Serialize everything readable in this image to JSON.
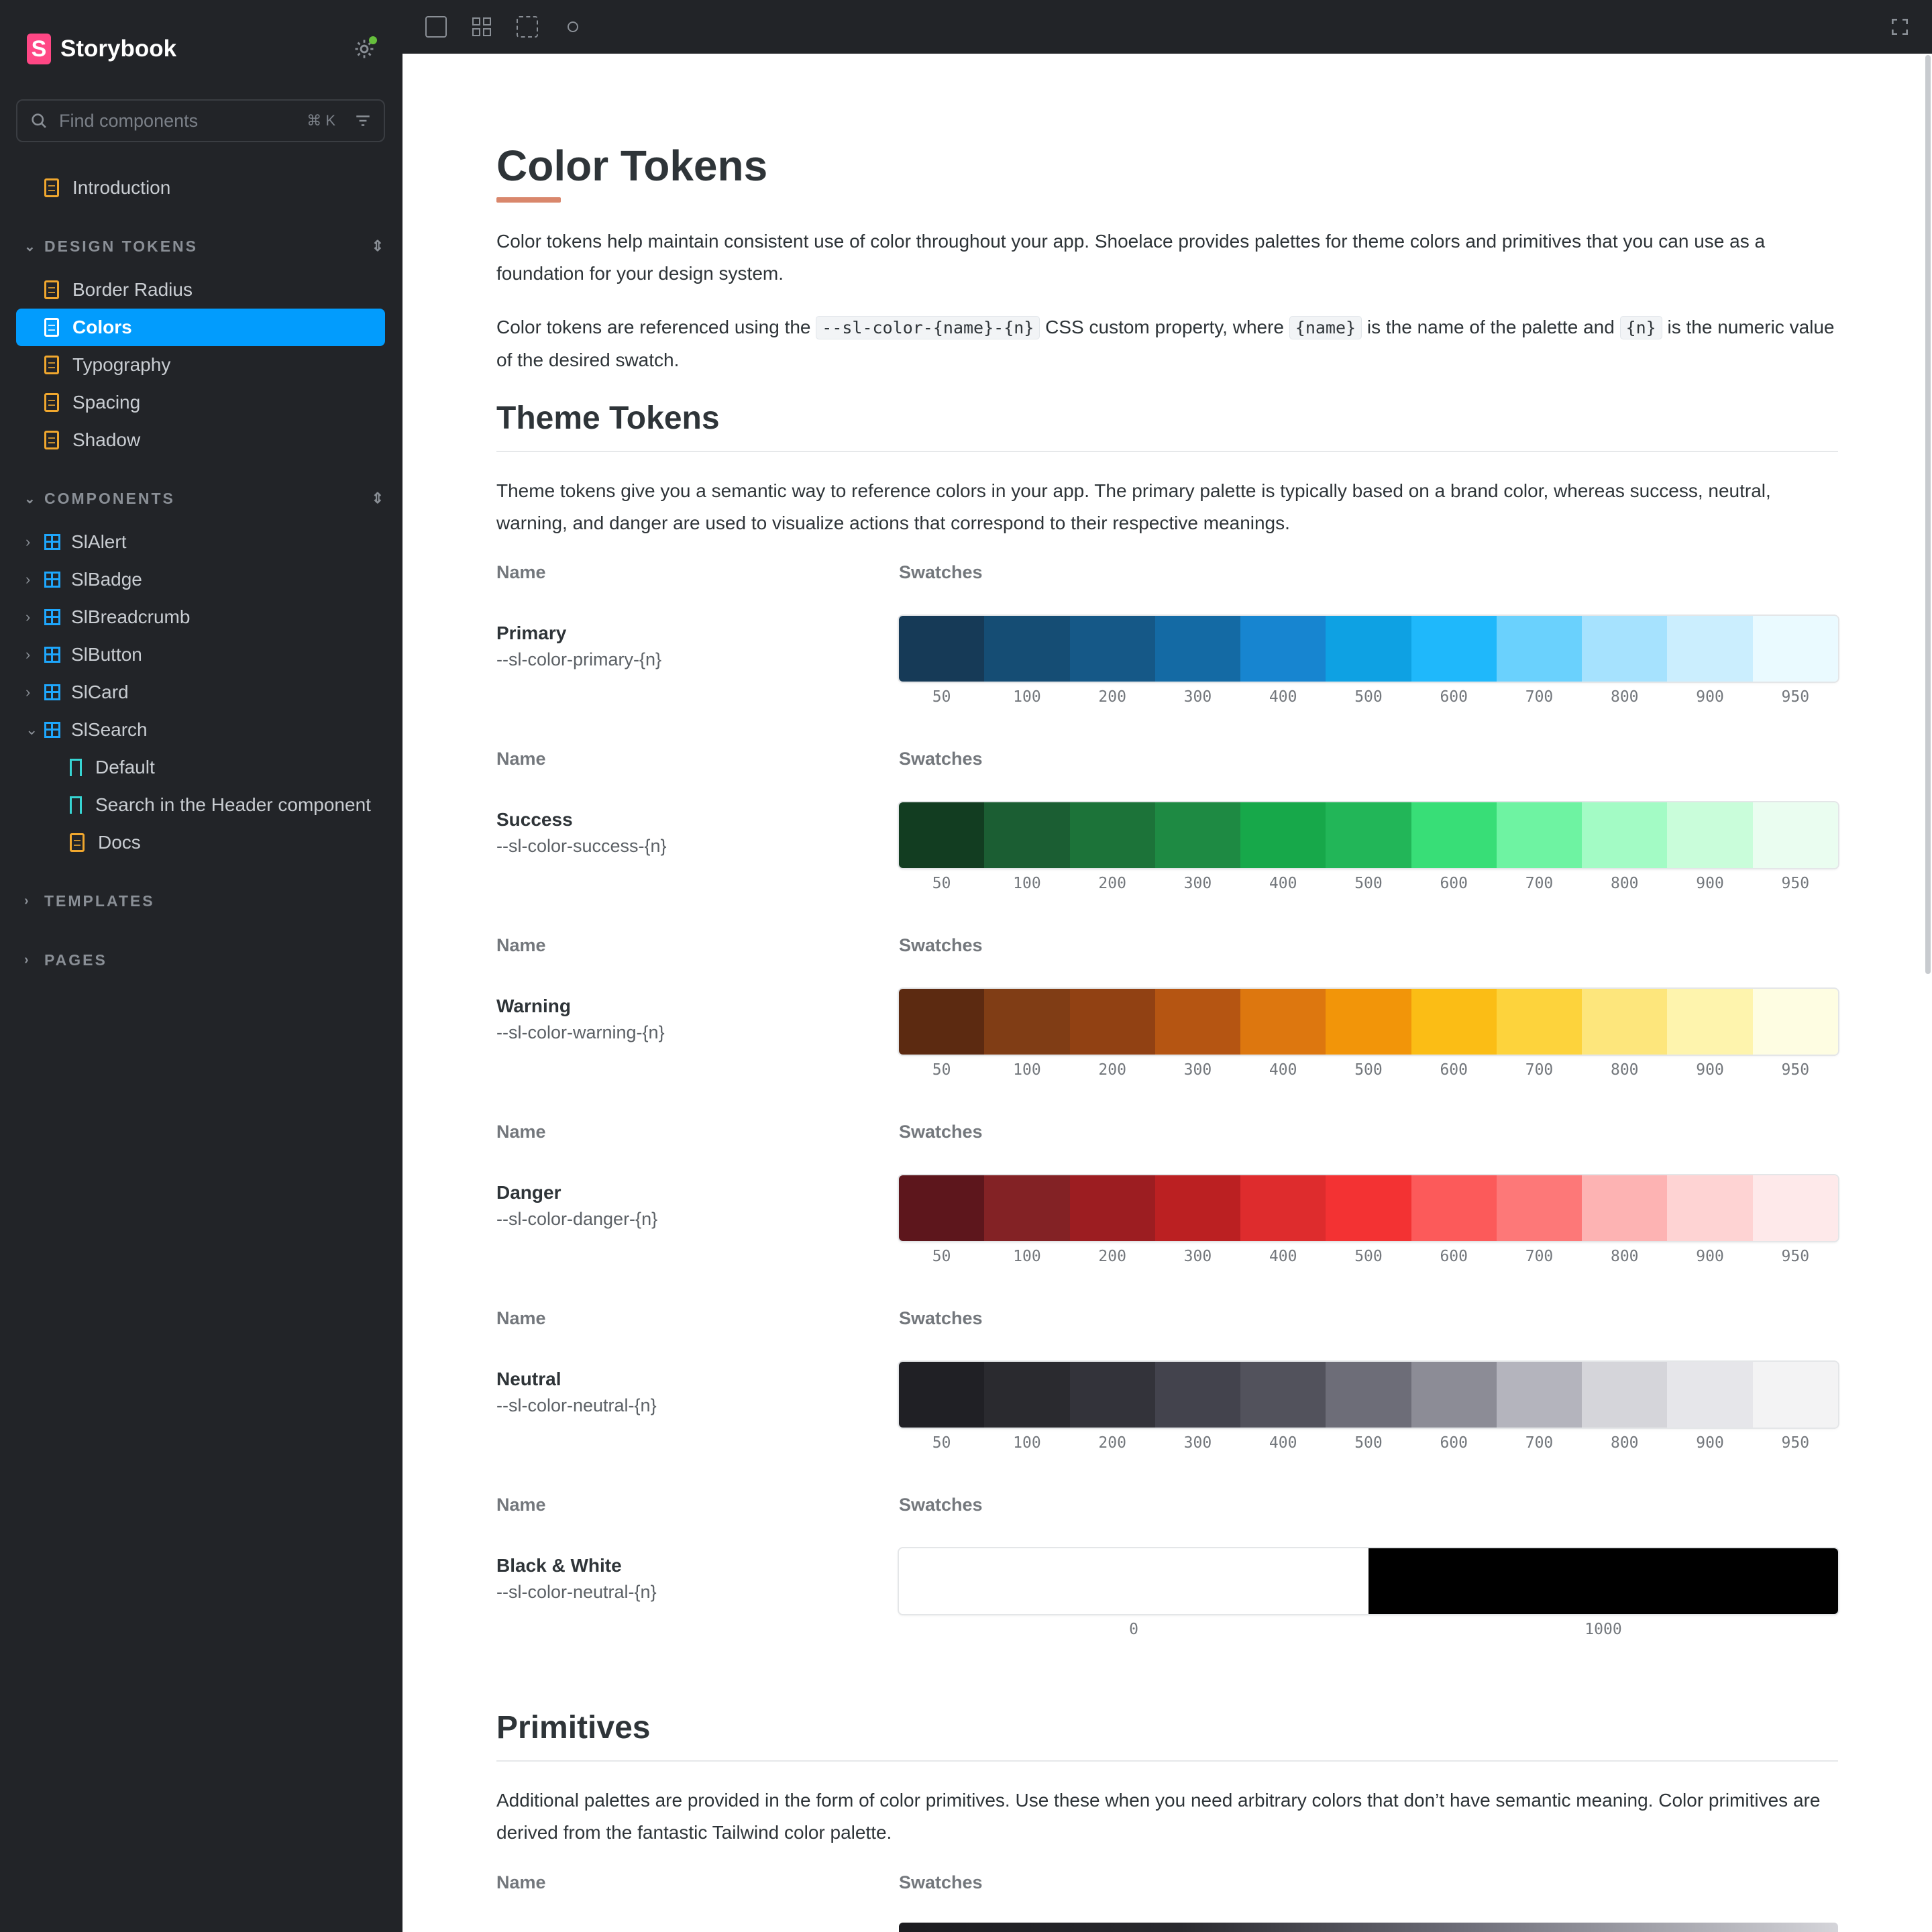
{
  "app": {
    "name": "Storybook",
    "logo_letter": "S"
  },
  "search": {
    "placeholder": "Find components",
    "shortcut": "⌘ K"
  },
  "sidebar": {
    "top_items": [
      {
        "label": "Introduction"
      }
    ],
    "sections": {
      "design_tokens": {
        "label": "DESIGN TOKENS",
        "items": [
          "Border Radius",
          "Colors",
          "Typography",
          "Spacing",
          "Shadow"
        ]
      },
      "components": {
        "label": "COMPONENTS",
        "items": [
          "SlAlert",
          "SlBadge",
          "SlBreadcrumb",
          "SlButton",
          "SlCard",
          "SlSearch"
        ]
      },
      "slsearch_children": [
        "Default",
        "Search in the Header component",
        "Docs"
      ],
      "templates": {
        "label": "TEMPLATES"
      },
      "pages": {
        "label": "PAGES"
      }
    },
    "active_item": "Colors"
  },
  "doc": {
    "title": "Color Tokens",
    "intro": "Color tokens help maintain consistent use of color throughout your app. Shoelace provides palettes for theme colors and primitives that you can use as a foundation for your design system.",
    "ref_1": "Color tokens are referenced using the",
    "ref_code_1": "--sl-color-{name}-{n}",
    "ref_2": "CSS custom property, where",
    "ref_code_2": "{name}",
    "ref_3": "is the name of the palette and",
    "ref_code_3": "{n}",
    "ref_4": "is the numeric value of the desired swatch.",
    "theme_heading": "Theme Tokens",
    "theme_text": "Theme tokens give you a semantic way to reference colors in your app. The primary palette is typically based on a brand color, whereas success, neutral, warning, and danger are used to visualize actions that correspond to their respective meanings.",
    "col_name": "Name",
    "col_swatches": "Swatches",
    "primitives_heading": "Primitives",
    "primitives_text": "Additional palettes are provided in the form of color primitives. Use these when you need arbitrary colors that don’t have semantic meaning. Color primitives are derived from the fantastic Tailwind color palette."
  },
  "palettes": [
    {
      "name": "Primary",
      "var": "--sl-color-primary-{n}",
      "labels": [
        "50",
        "100",
        "200",
        "300",
        "400",
        "500",
        "600",
        "700",
        "800",
        "900",
        "950"
      ],
      "colors": [
        "#163a57",
        "#154d74",
        "#155887",
        "#146aa4",
        "#1785d0",
        "#0ea1e3",
        "#1fb8fb",
        "#6ad1fd",
        "#a6e2fe",
        "#cbeefe",
        "#eafaff"
      ]
    },
    {
      "name": "Success",
      "var": "--sl-color-success-{n}",
      "labels": [
        "50",
        "100",
        "200",
        "300",
        "400",
        "500",
        "600",
        "700",
        "800",
        "900",
        "950"
      ],
      "colors": [
        "#123d21",
        "#1b5e33",
        "#1c7339",
        "#1e8a43",
        "#17a84a",
        "#22b658",
        "#38de77",
        "#6ef3a2",
        "#a3fbc5",
        "#c9fdda",
        "#eafdf0"
      ]
    },
    {
      "name": "Warning",
      "var": "--sl-color-warning-{n}",
      "labels": [
        "50",
        "100",
        "200",
        "300",
        "400",
        "500",
        "600",
        "700",
        "800",
        "900",
        "950"
      ],
      "colors": [
        "#5c2a11",
        "#803d15",
        "#914113",
        "#b55512",
        "#dd770f",
        "#f29509",
        "#fbbd15",
        "#fdd33c",
        "#fde67c",
        "#fef4ad",
        "#fefde2"
      ]
    },
    {
      "name": "Danger",
      "var": "--sl-color-danger-{n}",
      "labels": [
        "50",
        "100",
        "200",
        "300",
        "400",
        "500",
        "600",
        "700",
        "800",
        "900",
        "950"
      ],
      "colors": [
        "#5d161c",
        "#832225",
        "#9c1d21",
        "#bb2022",
        "#de2c2d",
        "#f33233",
        "#fc5a5a",
        "#fd7878",
        "#fdb3b3",
        "#fed3d3",
        "#fee9ea"
      ]
    },
    {
      "name": "Neutral",
      "var": "--sl-color-neutral-{n}",
      "labels": [
        "50",
        "100",
        "200",
        "300",
        "400",
        "500",
        "600",
        "700",
        "800",
        "900",
        "950"
      ],
      "colors": [
        "#202025",
        "#2a2a2f",
        "#33333a",
        "#43434d",
        "#52525c",
        "#6d6d78",
        "#8c8c96",
        "#b4b4bd",
        "#d5d5da",
        "#e6e6ea",
        "#f3f3f4"
      ]
    },
    {
      "name": "Black & White",
      "var": "--sl-color-neutral-{n}",
      "labels": [
        "0",
        "1000"
      ],
      "colors": [
        "#ffffff",
        "#000000"
      ]
    }
  ]
}
